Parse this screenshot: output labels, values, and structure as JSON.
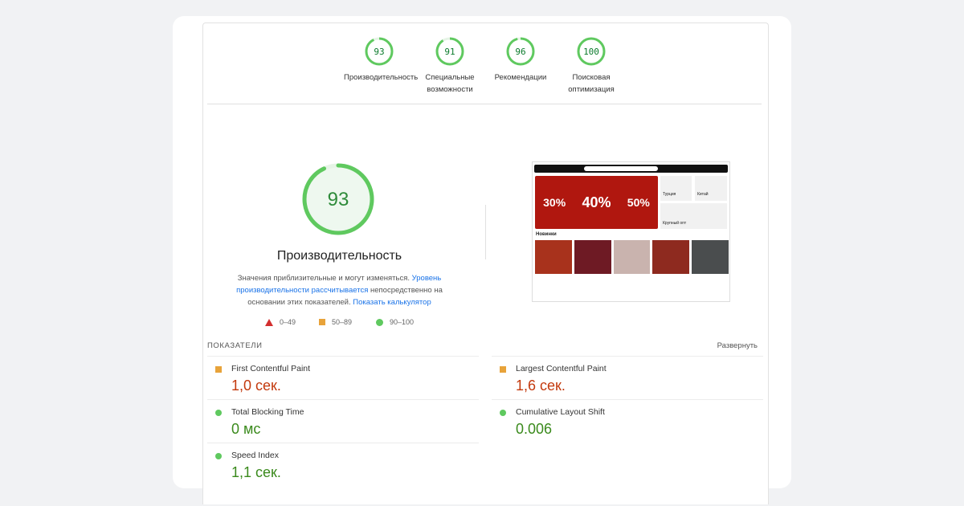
{
  "categories": [
    {
      "score": 93,
      "label": "Производительность"
    },
    {
      "score": 91,
      "label": "Специальные возможности"
    },
    {
      "score": 96,
      "label": "Рекомендации"
    },
    {
      "score": 100,
      "label": "Поисковая оптимизация"
    }
  ],
  "main": {
    "score": 93,
    "title": "Производительность",
    "desc_1": "Значения приблизительные и могут изменяться. ",
    "link_1": "Уровень производительности рассчитывается",
    "desc_2": " непосредственно на основании этих показателей. ",
    "link_2": "Показать калькулятор"
  },
  "legend": [
    "0–49",
    "50–89",
    "90–100"
  ],
  "metrics_header": "ПОКАЗАТЕЛИ",
  "expand": "Развернуть",
  "metrics": [
    {
      "label": "First Contentful Paint",
      "value": "1,0 сек.",
      "status": "average"
    },
    {
      "label": "Largest Contentful Paint",
      "value": "1,6 сек.",
      "status": "average"
    },
    {
      "label": "Total Blocking Time",
      "value": "0 мс",
      "status": "pass"
    },
    {
      "label": "Cumulative Layout Shift",
      "value": "0.006",
      "status": "pass"
    },
    {
      "label": "Speed Index",
      "value": "1,1 сек.",
      "status": "pass"
    }
  ],
  "screenshot": {
    "banner": [
      "30%",
      "40%",
      "50%"
    ],
    "section": "Новинки",
    "tiles": [
      "Турция",
      "Китай",
      "Крупный опт"
    ]
  },
  "colors": {
    "pass": "#0cce6b",
    "average": "#ffa400",
    "fail": "#ff4e42"
  }
}
